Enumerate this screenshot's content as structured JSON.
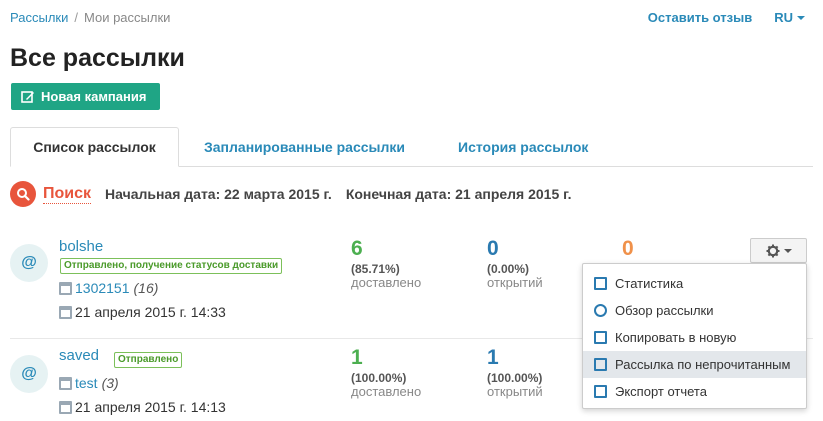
{
  "breadcrumb": {
    "root": "Рассылки",
    "separator": "/",
    "current": "Мои рассылки"
  },
  "header": {
    "feedback": "Оставить отзыв",
    "language": "RU"
  },
  "page_title": "Все рассылки",
  "new_campaign_label": "Новая кампания",
  "tabs": [
    {
      "label": "Список рассылок",
      "active": true
    },
    {
      "label": "Запланированные рассылки",
      "active": false
    },
    {
      "label": "История рассылок",
      "active": false
    }
  ],
  "search": {
    "label": "Поиск",
    "start_date": "Начальная дата: 22 марта 2015 г.",
    "end_date": "Конечная дата: 21 апреля 2015 г."
  },
  "mailings": [
    {
      "avatar": "@",
      "name": "bolshe",
      "status": "Отправлено, получение статусов доставки",
      "list_name": "1302151",
      "list_count": "(16)",
      "date": "21 апреля 2015 г. 14:33",
      "delivered": {
        "value": "6",
        "pct": "(85.71%)",
        "label": "доставлено"
      },
      "opened": {
        "value": "0",
        "pct": "(0.00%)",
        "label": "открытий"
      },
      "third": {
        "value": "0"
      }
    },
    {
      "avatar": "@",
      "name": "saved",
      "status": "Отправлено",
      "list_name": "test",
      "list_count": "(3)",
      "date": "21 апреля 2015 г. 14:13",
      "delivered": {
        "value": "1",
        "pct": "(100.00%)",
        "label": "доставлено"
      },
      "opened": {
        "value": "1",
        "pct": "(100.00%)",
        "label": "открытий"
      }
    }
  ],
  "actions_menu": {
    "items": [
      {
        "label": "Статистика",
        "icon": "chart-icon"
      },
      {
        "label": "Обзор рассылки",
        "icon": "eye-icon"
      },
      {
        "label": "Копировать в новую",
        "icon": "copy-icon"
      },
      {
        "label": "Рассылка по непрочитанным",
        "icon": "resend-icon",
        "highlighted": true
      },
      {
        "label": "Экспорт отчета",
        "icon": "export-icon"
      }
    ]
  },
  "colors": {
    "accent": "#2a8ab8",
    "button_green": "#1fa585",
    "search_red": "#e8553c",
    "delivered": "#4caf50",
    "opened": "#2a7ab0",
    "third": "#f0914a"
  }
}
